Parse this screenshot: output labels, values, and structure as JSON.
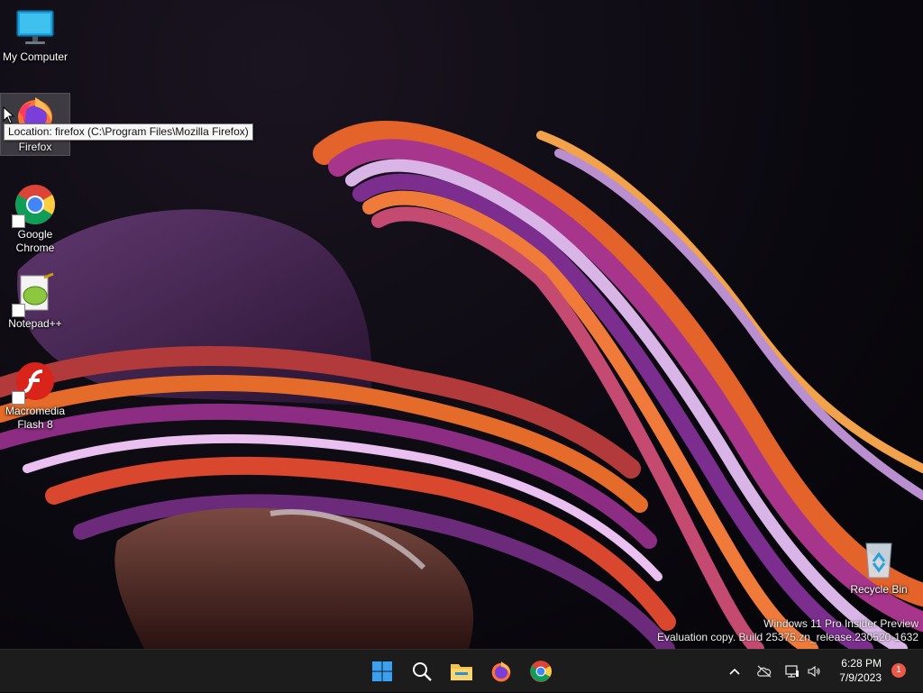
{
  "desktop": {
    "icons": [
      {
        "label": "My Computer",
        "icon": "monitor-icon"
      },
      {
        "label": "Firefox",
        "icon": "firefox-icon",
        "selected": true
      },
      {
        "label": "Google Chrome",
        "icon": "chrome-icon",
        "shortcut": true
      },
      {
        "label": "Notepad++",
        "icon": "notepadpp-icon",
        "shortcut": true
      },
      {
        "label": "Macromedia Flash 8",
        "icon": "flash-icon",
        "shortcut": true
      },
      {
        "label": "Recycle Bin",
        "icon": "recycle-bin-icon"
      }
    ],
    "tooltip": "Location: firefox (C:\\Program Files\\Mozilla Firefox)",
    "watermark": {
      "line1": "Windows 11 Pro Insider Preview",
      "line2": "Evaluation copy. Build 25375.zn_release.230520-1632"
    }
  },
  "taskbar": {
    "apps": [
      "start-icon",
      "search-icon",
      "file-explorer-icon",
      "firefox-icon",
      "chrome-icon"
    ],
    "tray": [
      "chevron-up-icon",
      "cloud-off-icon",
      "network-icon",
      "volume-icon"
    ],
    "time": "6:28 PM",
    "date": "7/9/2023",
    "notification_count": "1"
  },
  "colors": {
    "taskbar": "#1c1c1c",
    "accent": "#0078d4",
    "badge": "#e8594a"
  }
}
